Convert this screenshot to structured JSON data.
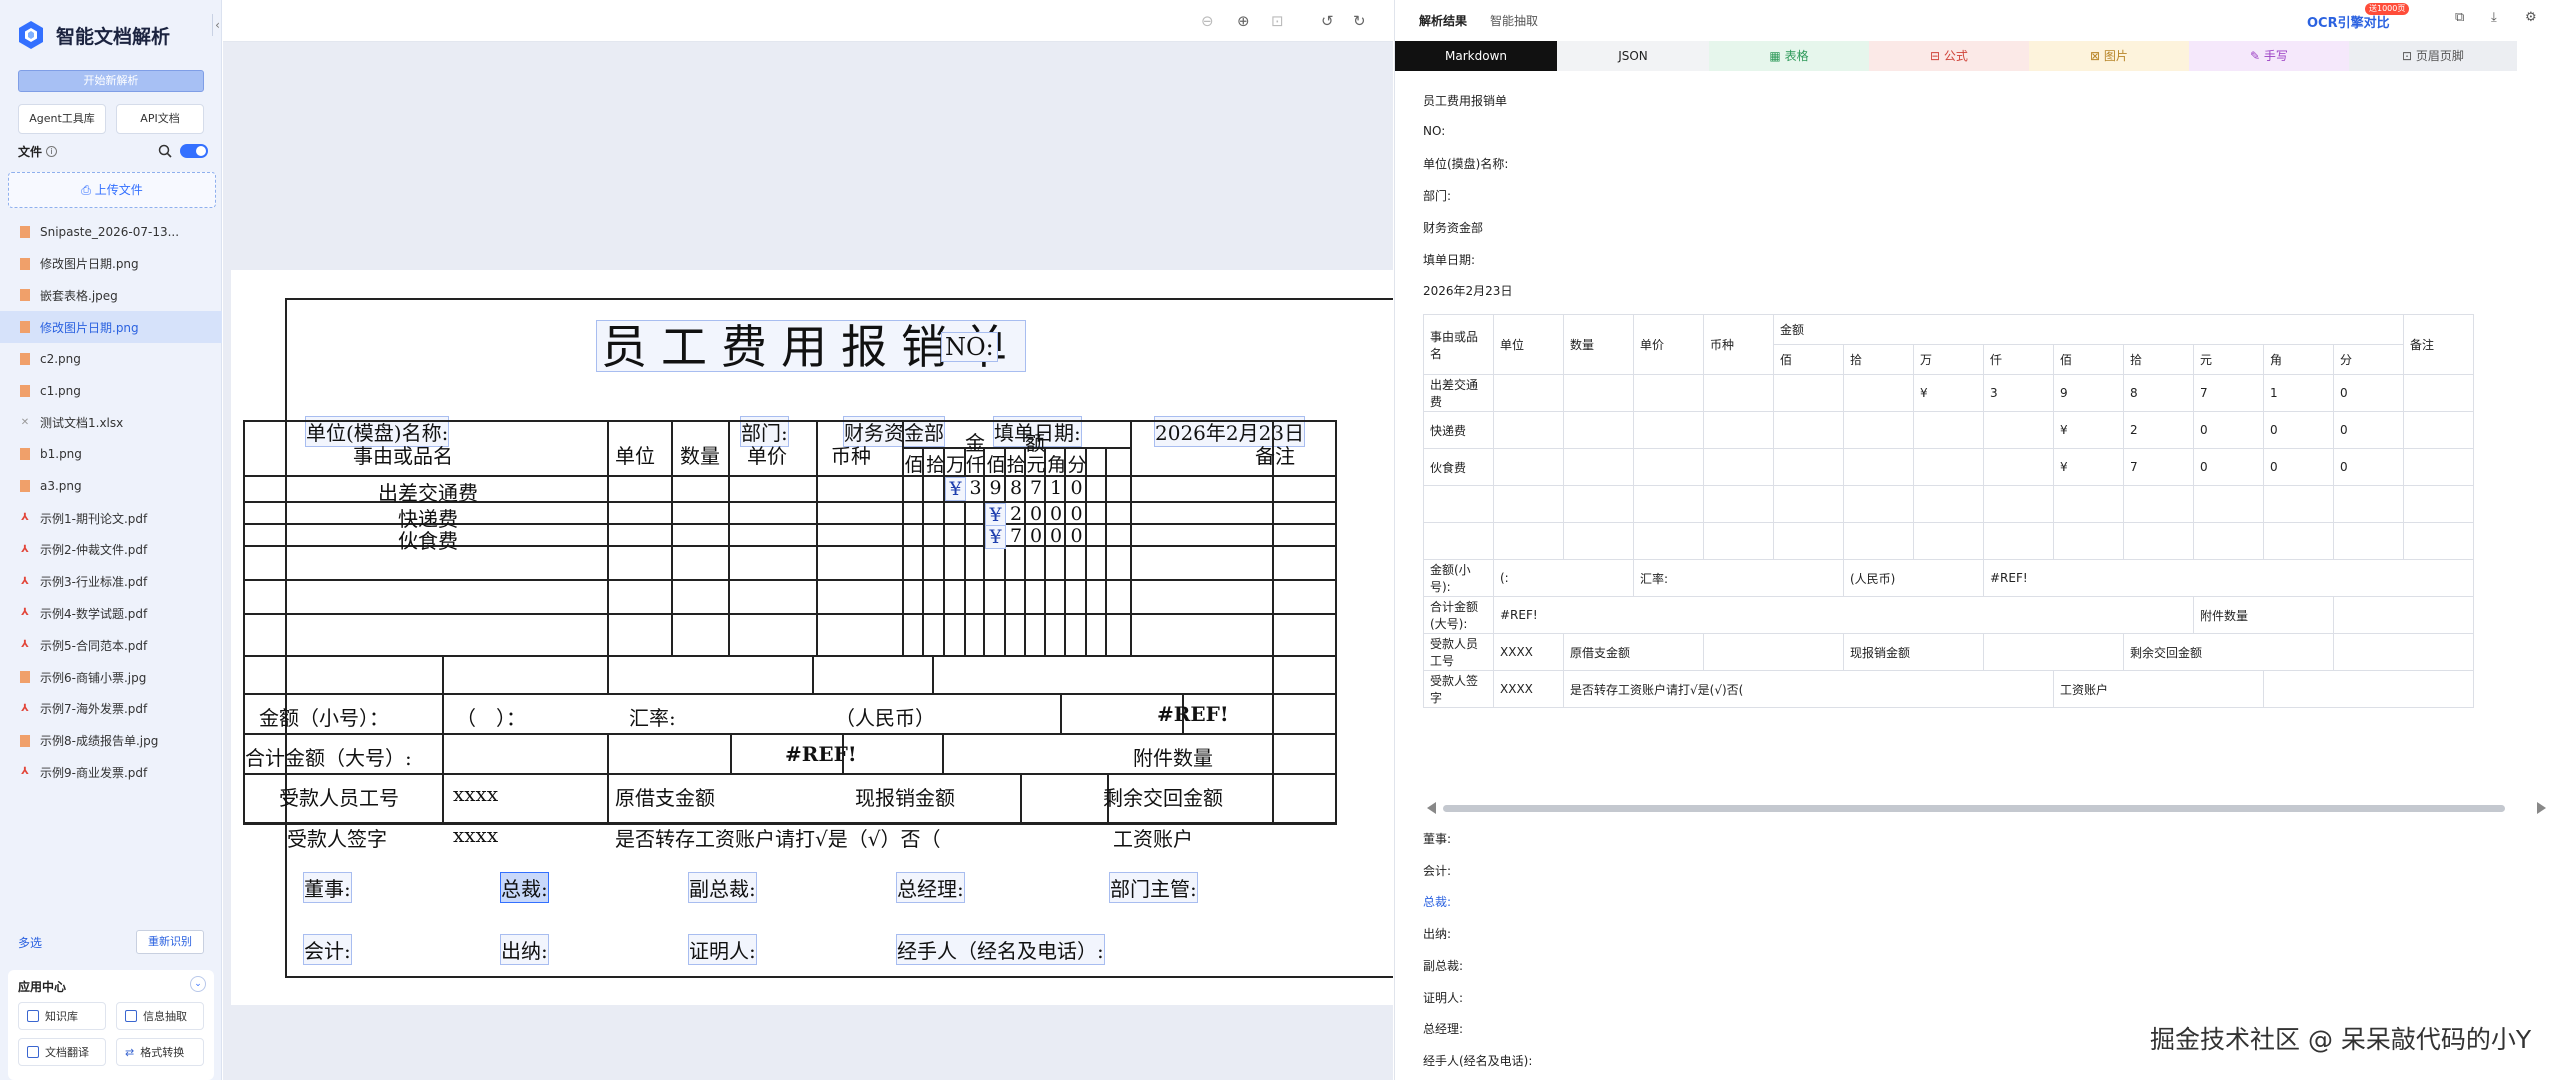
{
  "app": {
    "name": "智能文档解析",
    "new_parse": "开始新解析"
  },
  "sidebar": {
    "buttons": [
      "Agent工具库",
      "API文档"
    ],
    "files_label": "文件",
    "upload_label": "上传文件",
    "files": [
      {
        "name": "Snipaste_2026-07-13...",
        "type": "img"
      },
      {
        "name": "修改图片日期.png",
        "type": "img"
      },
      {
        "name": "嵌套表格.jpeg",
        "type": "img"
      },
      {
        "name": "修改图片日期.png",
        "type": "img",
        "active": true
      },
      {
        "name": "c2.png",
        "type": "img"
      },
      {
        "name": "c1.png",
        "type": "img"
      },
      {
        "name": "测试文档1.xlsx",
        "type": "xls"
      },
      {
        "name": "b1.png",
        "type": "img"
      },
      {
        "name": "a3.png",
        "type": "img"
      },
      {
        "name": "示例1-期刊论文.pdf",
        "type": "pdf"
      },
      {
        "name": "示例2-仲裁文件.pdf",
        "type": "pdf"
      },
      {
        "name": "示例3-行业标准.pdf",
        "type": "pdf"
      },
      {
        "name": "示例4-数学试题.pdf",
        "type": "pdf"
      },
      {
        "name": "示例5-合同范本.pdf",
        "type": "pdf"
      },
      {
        "name": "示例6-商铺小票.jpg",
        "type": "img"
      },
      {
        "name": "示例7-海外发票.pdf",
        "type": "pdf"
      },
      {
        "name": "示例8-成绩报告单.jpg",
        "type": "img"
      },
      {
        "name": "示例9-商业发票.pdf",
        "type": "pdf"
      }
    ],
    "multi_select": "多选",
    "re_recognize": "重新识别",
    "app_center": {
      "title": "应用中心",
      "items": [
        "知识库",
        "信息抽取",
        "文档翻译",
        "格式转换"
      ]
    }
  },
  "document": {
    "title": "员工费用报销单",
    "no_label": "NO:",
    "unit_label": "单位(模盘)名称:",
    "dept_label": "部门:",
    "dept_value": "财务资金部",
    "date_label": "填单日期:",
    "date_value": "2026年2月23日",
    "col_item": "事由或品名",
    "col_unit": "单位",
    "col_qty": "数量",
    "col_price": "单价",
    "col_currency": "币种",
    "col_amount": "金　　额",
    "col_note": "备注",
    "digit_heads": [
      "佰",
      "拾",
      "万",
      "仟",
      "佰",
      "拾",
      "元",
      "角",
      "分"
    ],
    "rows": [
      {
        "name": "出差交通费",
        "digits": [
          "",
          "",
          "¥",
          "3",
          "9",
          "8",
          "7",
          "1",
          "0"
        ]
      },
      {
        "name": "快递费",
        "digits": [
          "",
          "",
          "",
          "",
          "¥",
          "2",
          "0",
          "0",
          "0"
        ]
      },
      {
        "name": "伙食费",
        "digits": [
          "",
          "",
          "",
          "",
          "¥",
          "7",
          "0",
          "0",
          "0"
        ]
      }
    ],
    "small_amount_label": "金额（小号）：",
    "small_amount_paren": "（　）：",
    "rate_label": "汇率:",
    "rmb_label": "（人民币）",
    "ref1": "#REF!",
    "total_big_label": "合计金额（大号）:",
    "ref2": "#REF!",
    "attach_label": "附件数量",
    "payee_id_label": "受款人员工号",
    "payee_id": "xxxx",
    "orig_label": "原借支金额",
    "cash_label": "现报销金额",
    "refund_label": "剩余交回金额",
    "payee_sign_label": "受款人签字",
    "payee_sign": "xxxx",
    "transfer_text": "是否转存工资账户请打√是（√）否（",
    "salary_label": "工资账户",
    "sig_row1": [
      "董事:",
      "总裁:",
      "副总裁:",
      "总经理:",
      "部门主管:"
    ],
    "sig_row2": [
      "会计:",
      "出纳:",
      "证明人:",
      "经手人（经名及电话）:"
    ]
  },
  "result": {
    "tabs_top": [
      "解析结果",
      "智能抽取"
    ],
    "ocr_link": "OCR引擎对比",
    "badge": "送1000页",
    "view_tabs": [
      {
        "label": "Markdown",
        "active": true,
        "color": "#ffffff",
        "bg": "#111111"
      },
      {
        "label": "JSON",
        "color": "#222222",
        "bg": "#f2f3f5"
      },
      {
        "label": "表格",
        "color": "#2f9a5a",
        "bg": "#e6f6ec"
      },
      {
        "label": "公式",
        "color": "#d0443a",
        "bg": "#fbe9e7"
      },
      {
        "label": "图片",
        "color": "#b8862a",
        "bg": "#fdf3dc"
      },
      {
        "label": "手写",
        "color": "#9b3fc4",
        "bg": "#f5e8fb"
      },
      {
        "label": "页眉页脚",
        "color": "#555555",
        "bg": "#eceef2"
      }
    ],
    "lines_top": [
      "员工费用报销单",
      "NO:",
      "单位(摸盘)名称:",
      "部门:",
      "财务资金部",
      "填单日期:",
      "2026年2月23日"
    ],
    "table": {
      "head1": [
        "事由或品名",
        "单位",
        "数量",
        "单价",
        "币种",
        "金额",
        "备注"
      ],
      "head2": [
        "佰",
        "拾",
        "万",
        "仟",
        "佰",
        "拾",
        "元",
        "角",
        "分"
      ],
      "rows": [
        [
          "出差交通费",
          "",
          "",
          "",
          "",
          "",
          "",
          "¥",
          "3",
          "9",
          "8",
          "7",
          "1",
          "0",
          ""
        ],
        [
          "快递费",
          "",
          "",
          "",
          "",
          "",
          "",
          "",
          "",
          "¥",
          "2",
          "0",
          "0",
          "0",
          ""
        ],
        [
          "伙食费",
          "",
          "",
          "",
          "",
          "",
          "",
          "",
          "",
          "¥",
          "7",
          "0",
          "0",
          "0",
          ""
        ]
      ],
      "small_amount": {
        "label": "金额(小号):",
        "paren": "(:",
        "rate": "汇率:",
        "rmb": "(人民币)",
        "ref": "#REF!"
      },
      "total_big": {
        "label": "合计金额(大号):",
        "ref": "#REF!",
        "attach": "附件数量"
      },
      "payee_id": {
        "label": "受款人员工号",
        "value": "XXXX",
        "orig": "原借支金额",
        "cash": "现报销金额",
        "refund": "剩余交回金额"
      },
      "payee_sign": {
        "label": "受款人签字",
        "value": "XXXX",
        "transfer": "是否转存工资账户请打√是(√)否(",
        "salary": "工资账户"
      }
    },
    "lines_bottom": [
      "董事:",
      "会计:",
      "总裁:",
      "出纳:",
      "副总裁:",
      "证明人:",
      "总经理:",
      "经手人(经名及电话):"
    ]
  },
  "watermark": "掘金技术社区 @ 呆呆敲代码的小Y"
}
